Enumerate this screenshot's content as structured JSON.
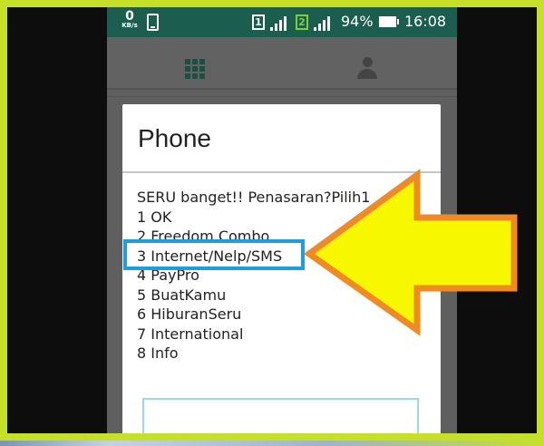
{
  "status_bar": {
    "net_speed": "0",
    "net_unit": "KB/s",
    "sim1_label": "1",
    "sim2_label": "2",
    "battery_percent": "94%",
    "time": "16:08"
  },
  "tabs": [
    {
      "icon": "dialpad-icon"
    },
    {
      "icon": "contacts-icon"
    }
  ],
  "dialog": {
    "title": "Phone",
    "lines": [
      "SERU banget!! Penasaran?Pilih1",
      "1 OK",
      "2 Freedom Combo",
      "3 Internet/Nelp/SMS",
      "4 PayPro",
      "5 BuatKamu",
      "6 HiburanSeru",
      "7 International",
      "8 Info"
    ],
    "reply_value": ""
  },
  "annotation": {
    "highlighted_option": "3 Internet/Nelp/SMS",
    "arrow_color": "#f7f700",
    "arrow_outline": "#f08a24",
    "highlight_color": "#1e9de0",
    "frame_color": "#c6e02a"
  }
}
